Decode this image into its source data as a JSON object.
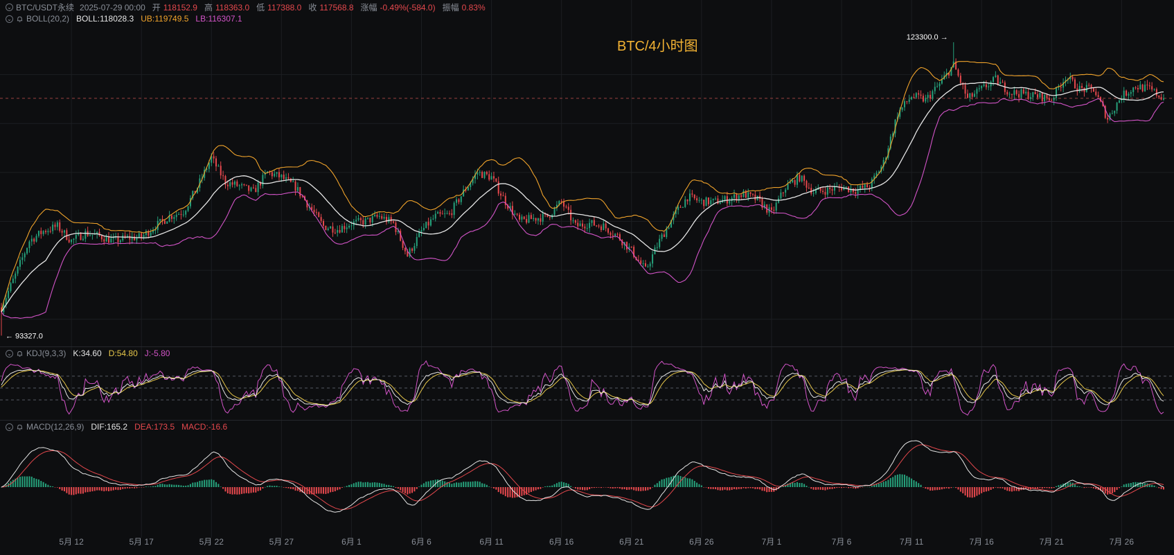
{
  "header": {
    "symbol": "BTC/USDT永续",
    "datetime": "2025-07-29 00:00",
    "open_label": "开",
    "open": "118152.9",
    "high_label": "高",
    "high": "118363.0",
    "low_label": "低",
    "low": "117388.0",
    "close_label": "收",
    "close": "117568.8",
    "change_label": "涨幅",
    "change": "-0.49%(-584.0)",
    "amplitude_label": "振幅",
    "amplitude": "0.83%"
  },
  "boll_legend": {
    "name": "BOLL(20,2)",
    "mid": "BOLL:118028.3",
    "ub": "UB:119749.5",
    "lb": "LB:116307.1"
  },
  "kdj_legend": {
    "name": "KDJ(9,3,3)",
    "k": "K:34.60",
    "d": "D:54.80",
    "j": "J:-5.80"
  },
  "macd_legend": {
    "name": "MACD(12,26,9)",
    "dif": "DIF:165.2",
    "dea": "DEA:173.5",
    "macd": "MACD:-16.6"
  },
  "colors": {
    "up": "#26a17b",
    "down": "#e5484d",
    "mid": "#e6e6e6",
    "ub": "#f0a32b",
    "lb": "#d354c8",
    "k": "#e6e6e6",
    "d": "#e8c84a",
    "j": "#d354c8",
    "dif": "#e6e6e6",
    "dea": "#e5484d",
    "title": "#f2b233",
    "grid": "#1c1e22"
  },
  "chart_data": {
    "type": "candlestick",
    "title": "BTC/4小时图",
    "interval": "4h",
    "price_range": [
      92500,
      124500
    ],
    "current_price": 117568.8,
    "annotations": [
      {
        "text": "123300.0",
        "date": "2025-07-14",
        "price": 123300.0,
        "kind": "high"
      },
      {
        "text": "93327.0",
        "date": "2025-05-07",
        "price": 93327.0,
        "kind": "low"
      }
    ],
    "x_ticks": [
      "5月 12",
      "5月 17",
      "5月 22",
      "5月 27",
      "6月 1",
      "6月 6",
      "6月 11",
      "6月 16",
      "6月 21",
      "6月 26",
      "7月 1",
      "7月 6",
      "7月 11",
      "7月 16",
      "7月 21",
      "7月 26"
    ],
    "x_tick_dates": [
      "2025-05-12",
      "2025-05-17",
      "2025-05-22",
      "2025-05-27",
      "2025-06-01",
      "2025-06-06",
      "2025-06-11",
      "2025-06-16",
      "2025-06-21",
      "2025-06-26",
      "2025-07-01",
      "2025-07-06",
      "2025-07-11",
      "2025-07-16",
      "2025-07-21",
      "2025-07-26"
    ],
    "date_range": [
      "2025-05-07",
      "2025-07-29"
    ],
    "close_path": [
      [
        "2025-05-07",
        96200
      ],
      [
        "2025-05-08",
        99500
      ],
      [
        "2025-05-09",
        103000
      ],
      [
        "2025-05-10",
        104000
      ],
      [
        "2025-05-11",
        104500
      ],
      [
        "2025-05-12",
        103000
      ],
      [
        "2025-05-13",
        103800
      ],
      [
        "2025-05-14",
        103500
      ],
      [
        "2025-05-15",
        103000
      ],
      [
        "2025-05-16",
        103300
      ],
      [
        "2025-05-17",
        103400
      ],
      [
        "2025-05-18",
        104500
      ],
      [
        "2025-05-19",
        105500
      ],
      [
        "2025-05-20",
        106000
      ],
      [
        "2025-05-21",
        108500
      ],
      [
        "2025-05-22",
        111500
      ],
      [
        "2025-05-23",
        109000
      ],
      [
        "2025-05-24",
        108600
      ],
      [
        "2025-05-25",
        108000
      ],
      [
        "2025-05-26",
        110000
      ],
      [
        "2025-05-27",
        109500
      ],
      [
        "2025-05-28",
        108500
      ],
      [
        "2025-05-29",
        106500
      ],
      [
        "2025-05-30",
        104500
      ],
      [
        "2025-05-31",
        104200
      ],
      [
        "2025-06-01",
        104800
      ],
      [
        "2025-06-02",
        105000
      ],
      [
        "2025-06-03",
        105500
      ],
      [
        "2025-06-04",
        104800
      ],
      [
        "2025-06-05",
        101500
      ],
      [
        "2025-06-06",
        104000
      ],
      [
        "2025-06-07",
        105500
      ],
      [
        "2025-06-08",
        105700
      ],
      [
        "2025-06-09",
        108000
      ],
      [
        "2025-06-10",
        110000
      ],
      [
        "2025-06-11",
        109500
      ],
      [
        "2025-06-12",
        107000
      ],
      [
        "2025-06-13",
        105000
      ],
      [
        "2025-06-14",
        105300
      ],
      [
        "2025-06-15",
        105500
      ],
      [
        "2025-06-16",
        107000
      ],
      [
        "2025-06-17",
        104500
      ],
      [
        "2025-06-18",
        104800
      ],
      [
        "2025-06-19",
        104500
      ],
      [
        "2025-06-20",
        103500
      ],
      [
        "2025-06-21",
        102000
      ],
      [
        "2025-06-22",
        100000
      ],
      [
        "2025-06-23",
        103000
      ],
      [
        "2025-06-24",
        105500
      ],
      [
        "2025-06-25",
        107500
      ],
      [
        "2025-06-26",
        107000
      ],
      [
        "2025-06-27",
        107000
      ],
      [
        "2025-06-28",
        107300
      ],
      [
        "2025-06-29",
        107800
      ],
      [
        "2025-06-30",
        107200
      ],
      [
        "2025-07-01",
        105800
      ],
      [
        "2025-07-02",
        108500
      ],
      [
        "2025-07-03",
        109500
      ],
      [
        "2025-07-04",
        108000
      ],
      [
        "2025-07-05",
        108200
      ],
      [
        "2025-07-06",
        108500
      ],
      [
        "2025-07-07",
        108200
      ],
      [
        "2025-07-08",
        108600
      ],
      [
        "2025-07-09",
        111000
      ],
      [
        "2025-07-10",
        116000
      ],
      [
        "2025-07-11",
        117800
      ],
      [
        "2025-07-12",
        117400
      ],
      [
        "2025-07-13",
        119000
      ],
      [
        "2025-07-14",
        121000
      ],
      [
        "2025-07-15",
        117500
      ],
      [
        "2025-07-16",
        118500
      ],
      [
        "2025-07-17",
        119500
      ],
      [
        "2025-07-18",
        118200
      ],
      [
        "2025-07-19",
        118000
      ],
      [
        "2025-07-20",
        117800
      ],
      [
        "2025-07-21",
        117500
      ],
      [
        "2025-07-22",
        119800
      ],
      [
        "2025-07-23",
        118500
      ],
      [
        "2025-07-24",
        118500
      ],
      [
        "2025-07-25",
        115500
      ],
      [
        "2025-07-26",
        117800
      ],
      [
        "2025-07-27",
        118800
      ],
      [
        "2025-07-28",
        118500
      ],
      [
        "2025-07-29",
        117568.8
      ]
    ],
    "indicators": [
      {
        "name": "BOLL(20,2)",
        "series": [
          "BOLL",
          "UB",
          "LB"
        ],
        "last": [
          118028.3,
          119749.5,
          116307.1
        ]
      },
      {
        "name": "KDJ(9,3,3)",
        "series": [
          "K",
          "D",
          "J"
        ],
        "last": [
          34.6,
          54.8,
          -5.8
        ],
        "guide_levels": [
          80,
          50,
          20
        ]
      },
      {
        "name": "MACD(12,26,9)",
        "series": [
          "DIF",
          "DEA",
          "MACD"
        ],
        "last": [
          165.2,
          173.5,
          -16.6
        ]
      }
    ]
  }
}
